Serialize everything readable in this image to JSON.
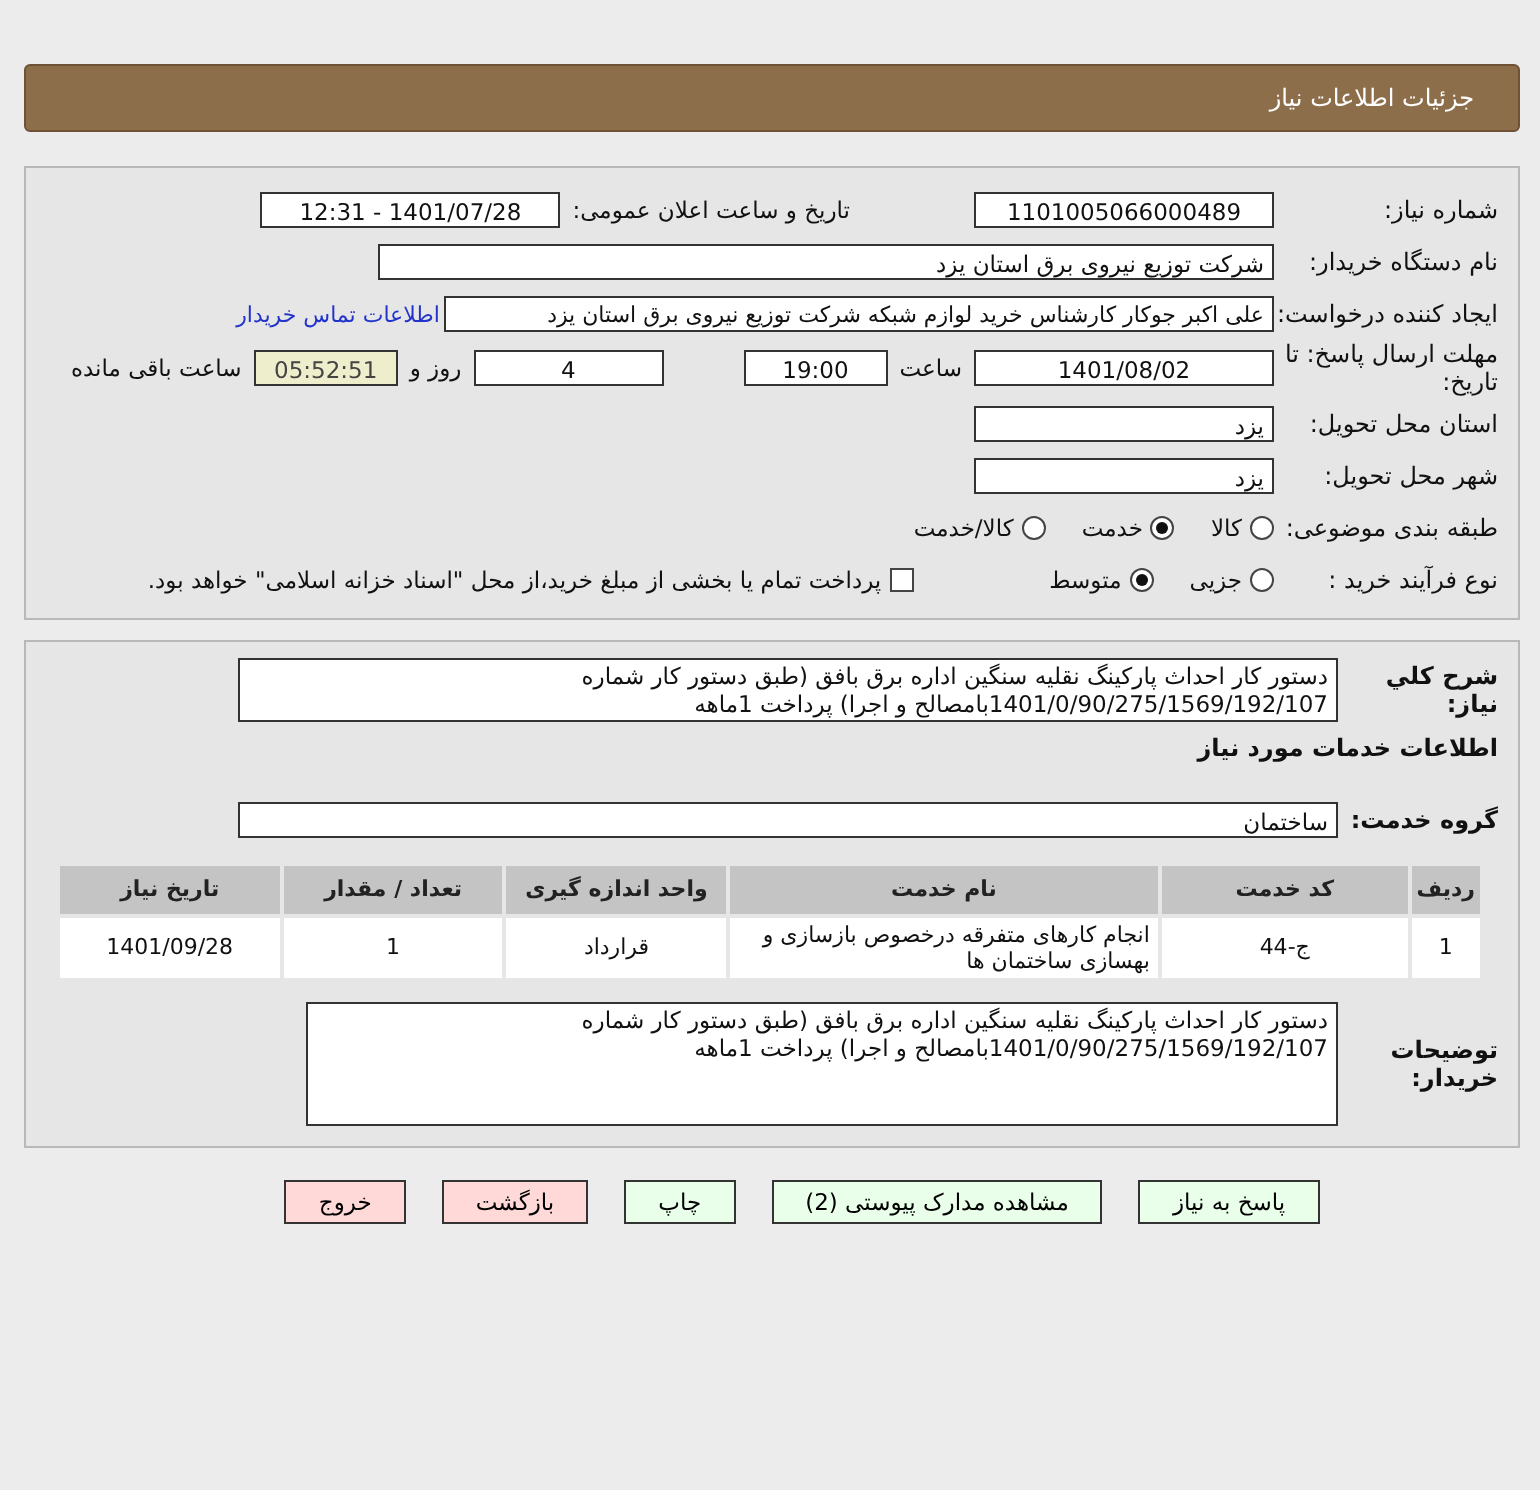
{
  "header": {
    "title": "جزئیات اطلاعات نیاز"
  },
  "details": {
    "need_number": {
      "label": "شماره نیاز:",
      "value": "1101005066000489"
    },
    "announce": {
      "label": "تاریخ و ساعت اعلان عمومی:",
      "value": "1401/07/28 - 12:31"
    },
    "buyer": {
      "label": "نام دستگاه خریدار:",
      "value": "شرکت توزیع نیروی برق استان یزد"
    },
    "requester": {
      "label": "ایجاد کننده درخواست:",
      "value": "علی اکبر  جوکار  کارشناس خرید لوازم شبکه  شرکت توزیع نیروی برق استان یزد",
      "link": "اطلاعات تماس خریدار"
    },
    "deadline": {
      "label": "مهلت ارسال پاسخ: تا تاریخ:",
      "date": "1401/08/02",
      "time_label": "ساعت",
      "time": "19:00",
      "days": "4",
      "days_label": "روز و",
      "remaining": "05:52:51",
      "remaining_label": "ساعت باقی مانده"
    },
    "province": {
      "label": "استان محل تحویل:",
      "value": "یزد"
    },
    "city": {
      "label": "شهر محل تحویل:",
      "value": "یزد"
    },
    "category": {
      "label": "طبقه بندی موضوعی:",
      "options": [
        {
          "label": "کالا",
          "selected": false
        },
        {
          "label": "خدمت",
          "selected": true
        },
        {
          "label": "کالا/خدمت",
          "selected": false
        }
      ]
    },
    "process": {
      "label": "نوع فرآیند خرید :",
      "options": [
        {
          "label": "جزیی",
          "selected": false
        },
        {
          "label": "متوسط",
          "selected": true
        }
      ],
      "treasury": {
        "label": "پرداخت تمام یا بخشی از مبلغ خرید،از محل \"اسناد خزانه اسلامی\" خواهد بود.",
        "checked": false
      }
    }
  },
  "services": {
    "summary": {
      "label": "شرح کلي نياز:",
      "value": "دستور کار احداث پارکینگ نقلیه سنگین اداره برق بافق (طبق دستور کار شماره 1401/0/90/275/1569/192/107بامصالح و اجرا) پرداخت 1ماهه"
    },
    "section_title": "اطلاعات خدمات مورد نیاز",
    "group": {
      "label": "گروه خدمت:",
      "value": "ساختمان"
    },
    "table": {
      "columns": [
        "ردیف",
        "کد خدمت",
        "نام خدمت",
        "واحد اندازه گیری",
        "تعداد / مقدار",
        "تاریخ نیاز"
      ],
      "rows": [
        [
          "1",
          "ج-44",
          "انجام کارهای متفرقه درخصوص بازسازی و بهسازی ساختمان ها",
          "قرارداد",
          "1",
          "1401/09/28"
        ]
      ]
    },
    "buyer_notes": {
      "label": "توضیحات خریدار:",
      "value": "دستور کار احداث پارکینگ نقلیه سنگین اداره برق بافق (طبق دستور کار شماره 1401/0/90/275/1569/192/107بامصالح و اجرا) پرداخت 1ماهه"
    }
  },
  "buttons": [
    {
      "label": "پاسخ به نیاز",
      "kind": "action"
    },
    {
      "label": "مشاهده مدارک پیوستی (2)",
      "kind": "action"
    },
    {
      "label": "چاپ",
      "kind": "action"
    },
    {
      "label": "بازگشت",
      "kind": "exit"
    },
    {
      "label": "خروج",
      "kind": "exit"
    }
  ]
}
